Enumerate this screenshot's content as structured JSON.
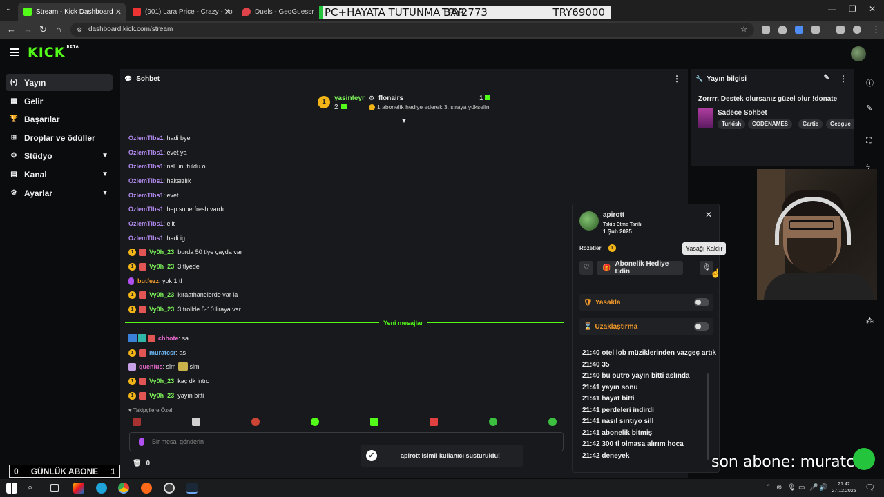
{
  "browser": {
    "tabs": [
      {
        "label": "Stream - Kick Dashboard",
        "active": true
      },
      {
        "label": "(901) Lara Price - Crazy - Yo",
        "active": false
      },
      {
        "label": "Duels - GeoGuessr",
        "active": false
      }
    ],
    "overlay": {
      "text": "PC+HAYATA TUTUNMA BAR",
      "mid": "TRY2773",
      "right": "TRY69000"
    },
    "url": "dashboard.kick.com/stream"
  },
  "header": {
    "logo": "KICK",
    "logo_sup": "BETA"
  },
  "sidebar": {
    "items": [
      {
        "label": "Yayın",
        "icon": "(•)",
        "active": true,
        "expandable": false
      },
      {
        "label": "Gelir",
        "icon": "▦",
        "active": false,
        "expandable": false
      },
      {
        "label": "Başarılar",
        "icon": "🏆",
        "active": false,
        "expandable": false
      },
      {
        "label": "Droplar ve ödüller",
        "icon": "⊞",
        "active": false,
        "expandable": false
      },
      {
        "label": "Stüdyo",
        "icon": "⚙",
        "active": false,
        "expandable": true
      },
      {
        "label": "Kanal",
        "icon": "▤",
        "active": false,
        "expandable": true
      },
      {
        "label": "Ayarlar",
        "icon": "⚙",
        "active": false,
        "expandable": true
      }
    ],
    "sub_counter": {
      "left": "0",
      "label": "GÜNLÜK ABONE",
      "right": "1"
    }
  },
  "chat": {
    "title": "Sohbet",
    "pinned": {
      "rank": "1",
      "user1": "yasinteyr",
      "user1_count": "2",
      "user2": "flonairs",
      "user2_count": "1",
      "subtitle": "1 abonelik hediye ederek 3. sıraya yükselin"
    },
    "messages": [
      {
        "user": "OzlemTlbs1",
        "text": ": hadi bye",
        "color": "purple",
        "badges": false
      },
      {
        "user": "OzlemTlbs1",
        "text": ": evet ya",
        "color": "purple",
        "badges": false
      },
      {
        "user": "OzlemTlbs1",
        "text": ": nsl unutuldu o",
        "color": "purple",
        "badges": false
      },
      {
        "user": "OzlemTlbs1",
        "text": ": haksızlık",
        "color": "purple",
        "badges": false
      },
      {
        "user": "OzlemTlbs1",
        "text": ": evet",
        "color": "purple",
        "badges": false
      },
      {
        "user": "OzlemTlbs1",
        "text": ": hep superfresh vardı",
        "color": "purple",
        "badges": false
      },
      {
        "user": "OzlemTlbs1",
        "text": ": eilt",
        "color": "purple",
        "badges": false
      },
      {
        "user": "OzlemTlbs1",
        "text": ": hadi ig",
        "color": "purple",
        "badges": false
      },
      {
        "user": "Vy0h_23",
        "text": ": burda 50 tlye çayda var",
        "color": "green",
        "badges": true
      },
      {
        "user": "Vy0h_23",
        "text": ": 3 tlyede",
        "color": "green",
        "badges": true
      },
      {
        "user": "butfezz",
        "text": ": yok 1 tl",
        "color": "orange",
        "badges": false
      },
      {
        "user": "Vy0h_23",
        "text": ": kıraathanelerde var la",
        "color": "green",
        "badges": true
      },
      {
        "user": "Vy0h_23",
        "text": ": 3 trollde 5-10 liraya var",
        "color": "green",
        "badges": true
      }
    ],
    "new_messages_label": "Yeni mesajlar",
    "new_messages": [
      {
        "user": "chhote",
        "text": ": sa",
        "color": "pink",
        "badges": false
      },
      {
        "user": "muratcsr",
        "text": ": as",
        "color": "blue",
        "badges": true
      },
      {
        "user": "quenius",
        "text": ": slm",
        "color": "pink",
        "badges": false,
        "suffix": " slm"
      },
      {
        "user": "Vy0h_23",
        "text": ": kaç dk intro",
        "color": "green",
        "badges": true
      },
      {
        "user": "Vy0h_23",
        "text": ": yayın bitti",
        "color": "green",
        "badges": true
      }
    ],
    "followers_label": "Takipçilere Özel",
    "input_placeholder": "Bir mesaj gönderin",
    "points": "0"
  },
  "user_popup": {
    "username": "apirott",
    "follow_label": "Takip Etme Tarihi",
    "follow_date": "1 Şub 2025",
    "badges_label": "Rozetler",
    "badge_value": "1",
    "gift_button": "Abonelik Hediye Edin",
    "tooltip": "Yasağı Kaldır",
    "ban_label": "Yasakla",
    "timeout_label": "Uzaklaştırma",
    "history": [
      {
        "time": "21:40",
        "text": "otel lob müziklerinden vazgeç artık"
      },
      {
        "time": "21:40",
        "text": "35"
      },
      {
        "time": "21:40",
        "text": "bu outro yayın bitti aslında"
      },
      {
        "time": "21:41",
        "text": "yayın sonu"
      },
      {
        "time": "21:41",
        "text": "hayat bitti"
      },
      {
        "time": "21:41",
        "text": "perdeleri indirdi"
      },
      {
        "time": "21:41",
        "text": "nasıl sırıtıyo sill"
      },
      {
        "time": "21:41",
        "text": "abonelik bitmiş"
      },
      {
        "time": "21:42",
        "text": "300 tl olmasa alırım hoca"
      },
      {
        "time": "21:42",
        "text": "deneyek"
      }
    ]
  },
  "stream_info": {
    "title": "Yayın bilgisi",
    "stream_title": "Zorrrr. Destek olursanız güzel olur !donate",
    "category": "Sadece Sohbet",
    "tags": [
      "Turkish",
      "CODENAMES",
      "Gartic",
      "Geogue"
    ]
  },
  "toast": {
    "text": "apirott isimli kullanıcı susturuldu!"
  },
  "overlay_last_sub": "son abone: muratcsr",
  "taskbar": {
    "time": "21:42",
    "date": "27.12.2025"
  },
  "colors": {
    "kick_green": "#53fc18",
    "badge_gold": "#f2b416",
    "panel_bg": "#18191c"
  }
}
